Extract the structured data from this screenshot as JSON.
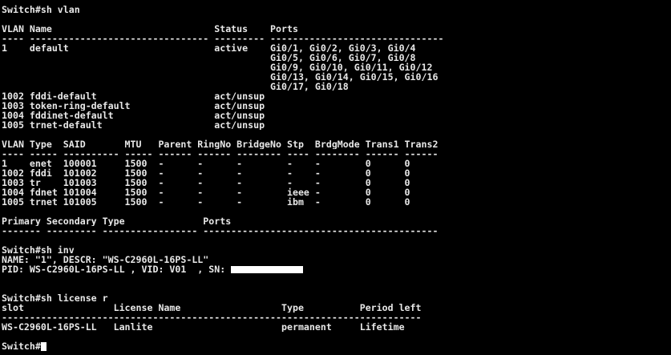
{
  "terminal": {
    "colors": {
      "background": "#000000",
      "foreground": "#e8e8e8",
      "redaction": "#ffffff",
      "cursor": "#ffffff"
    },
    "lines": [
      "Switch#sh vlan",
      "",
      "VLAN Name                             Status    Ports",
      "---- -------------------------------- --------- -------------------------------",
      "1    default                          active    Gi0/1, Gi0/2, Gi0/3, Gi0/4",
      "                                                Gi0/5, Gi0/6, Gi0/7, Gi0/8",
      "                                                Gi0/9, Gi0/10, Gi0/11, Gi0/12",
      "                                                Gi0/13, Gi0/14, Gi0/15, Gi0/16",
      "                                                Gi0/17, Gi0/18",
      "1002 fddi-default                     act/unsup",
      "1003 token-ring-default               act/unsup",
      "1004 fddinet-default                  act/unsup",
      "1005 trnet-default                    act/unsup",
      "",
      "VLAN Type  SAID       MTU   Parent RingNo BridgeNo Stp  BrdgMode Trans1 Trans2",
      "---- ----- ---------- ----- ------ ------ -------- ---- -------- ------ ------",
      "1    enet  100001     1500  -      -      -        -    -        0      0",
      "1002 fddi  101002     1500  -      -      -        -    -        0      0",
      "1003 tr    101003     1500  -      -      -        -    -        0      0",
      "1004 fdnet 101004     1500  -      -      -        ieee -        0      0",
      "1005 trnet 101005     1500  -      -      -        ibm  -        0      0",
      "",
      "Primary Secondary Type              Ports",
      "------- --------- ----------------- ------------------------------------------",
      "",
      "Switch#sh inv",
      "NAME: \"1\", DESCR: \"WS-C2960L-16PS-LL\"",
      "PID: WS-C2960L-16PS-LL , VID: V01  , SN: ",
      "",
      "",
      "Switch#sh license r",
      "slot                License Name                  Type          Period left",
      "---------------------------------------------------------------------------",
      "WS-C2960L-16PS-LL   Lanlite                       permanent     Lifetime",
      "",
      "Switch#"
    ]
  }
}
